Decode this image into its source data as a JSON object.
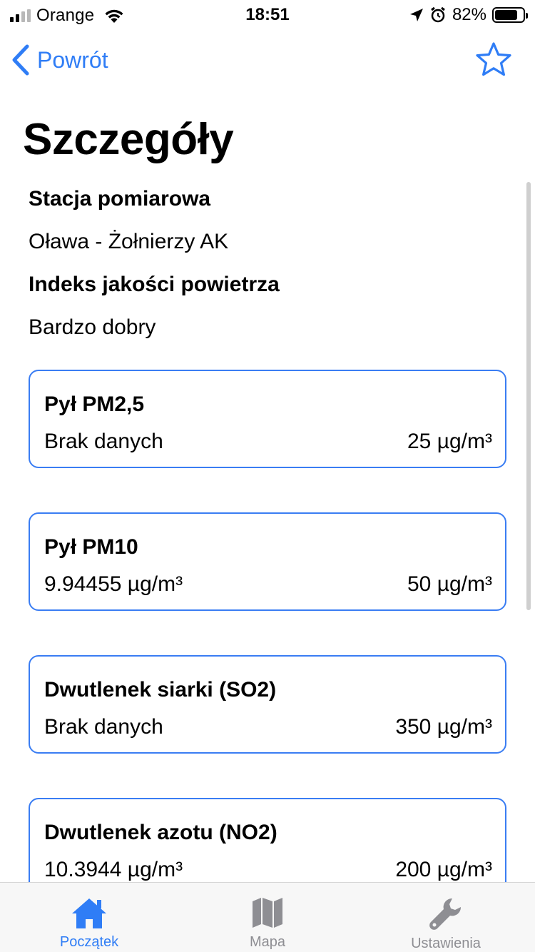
{
  "status_bar": {
    "carrier": "Orange",
    "time": "18:51",
    "battery": "82%",
    "battery_level": 0.82
  },
  "nav": {
    "back_label": "Powrót"
  },
  "page": {
    "title": "Szczegóły"
  },
  "details": {
    "station_label": "Stacja pomiarowa",
    "station_value": "Oława - Żołnierzy AK",
    "index_label": "Indeks jakości powietrza",
    "index_value": "Bardzo dobry"
  },
  "cards": [
    {
      "name": "Pył PM2,5",
      "value": "Brak danych",
      "limit": "25 µg/m³"
    },
    {
      "name": "Pył PM10",
      "value": "9.94455 µg/m³",
      "limit": "50 µg/m³"
    },
    {
      "name": "Dwutlenek siarki (SO2)",
      "value": "Brak danych",
      "limit": "350 µg/m³"
    },
    {
      "name": "Dwutlenek azotu (NO2)",
      "value": "10.3944 µg/m³",
      "limit": "200 µg/m³"
    }
  ],
  "tabbar": {
    "items": [
      {
        "label": "Początek",
        "icon": "house-icon",
        "active": true
      },
      {
        "label": "Mapa",
        "icon": "map-icon",
        "active": false
      },
      {
        "label": "Ustawienia",
        "icon": "wrench-icon",
        "active": false
      }
    ]
  },
  "colors": {
    "accent": "#2f7df6",
    "card_border": "#3a7df3",
    "inactive": "#8e8e93"
  }
}
